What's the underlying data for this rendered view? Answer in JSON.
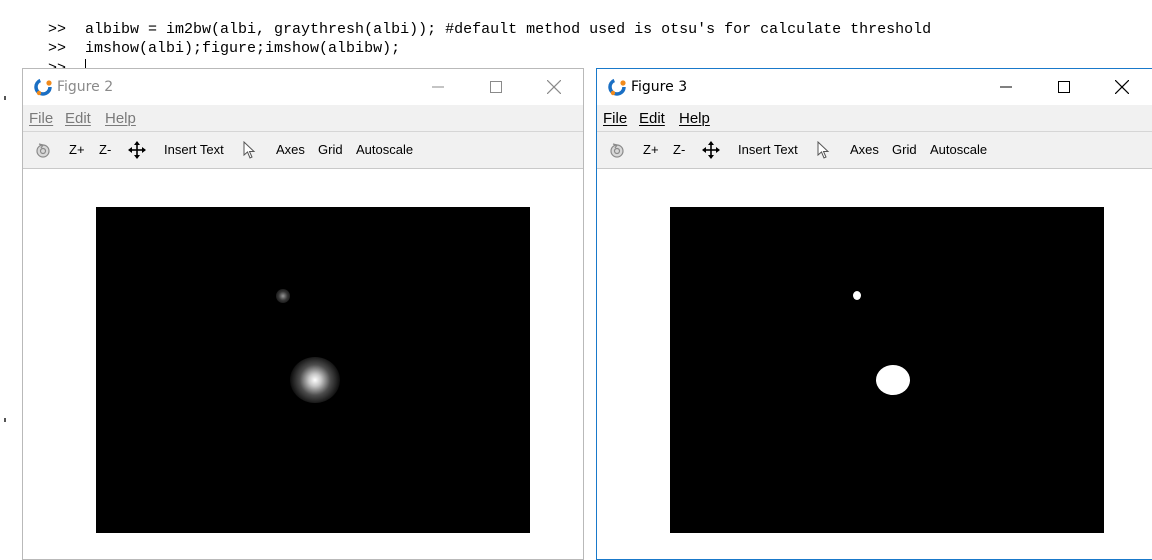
{
  "console": {
    "lines": [
      {
        "prompt": ">>",
        "text": " albibw = im2bw(albi, graythresh(albi)); #default method used is otsu's for calculate threshold"
      },
      {
        "prompt": ">>",
        "text": " imshow(albi);figure;imshow(albibw);"
      },
      {
        "prompt": ">>",
        "text": " "
      }
    ]
  },
  "figures": [
    {
      "title": "Figure 2",
      "state": "inactive",
      "menu": [
        "File",
        "Edit",
        "Help"
      ],
      "toolbar": {
        "zoom_in": "Z+",
        "zoom_out": "Z-",
        "insert_text": "Insert Text",
        "axes": "Axes",
        "grid": "Grid",
        "autoscale": "Autoscale"
      },
      "image": "grayscale"
    },
    {
      "title": "Figure 3",
      "state": "active",
      "menu": [
        "File",
        "Edit",
        "Help"
      ],
      "toolbar": {
        "zoom_in": "Z+",
        "zoom_out": "Z-",
        "insert_text": "Insert Text",
        "axes": "Axes",
        "grid": "Grid",
        "autoscale": "Autoscale"
      },
      "image": "binary"
    }
  ],
  "icons": {
    "app": "octave-logo-icon",
    "rotate": "rotate-icon",
    "pan": "pan-move-icon",
    "select": "pointer-arrow-icon",
    "minimize": "minimize-icon",
    "maximize": "maximize-icon",
    "close": "close-icon"
  },
  "colors": {
    "active_border": "#1979ca",
    "image_background": "#000000",
    "blob_white": "#ffffff"
  }
}
